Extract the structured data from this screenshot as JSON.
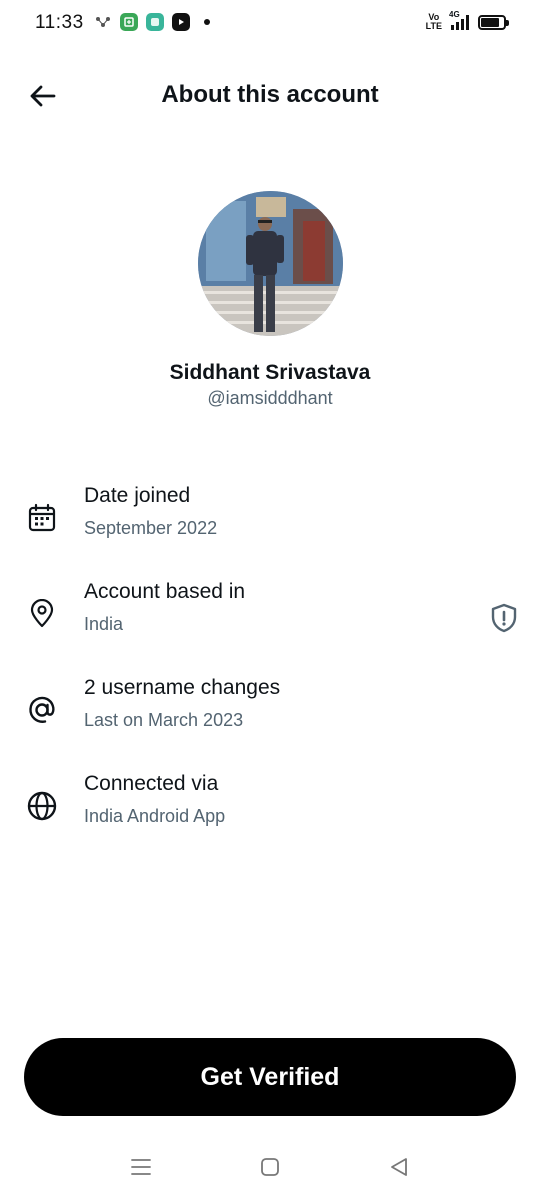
{
  "status_bar": {
    "time": "11:33",
    "network_label": "4G",
    "volte_top": "Vo",
    "volte_bottom": "LTE",
    "left_icons": [
      "phone-link-icon",
      "app-icon-green",
      "app-icon-teal",
      "youtube-icon",
      "notification-dot"
    ],
    "battery_level": 0.8
  },
  "header": {
    "title": "About this account"
  },
  "profile": {
    "name": "Siddhant Srivastava",
    "handle": "@iamsidddhant"
  },
  "info": [
    {
      "icon": "calendar-icon",
      "label": "Date joined",
      "value": "September 2022"
    },
    {
      "icon": "location-pin-icon",
      "label": "Account based in",
      "value": "India"
    },
    {
      "icon": "at-sign-icon",
      "label": "2 username changes",
      "value": "Last on March 2023"
    },
    {
      "icon": "globe-icon",
      "label": "Connected via",
      "value": "India Android App"
    }
  ],
  "cta": {
    "label": "Get Verified"
  },
  "colors": {
    "primary_text": "#0f1419",
    "secondary_text": "#536471",
    "button_bg": "#000000",
    "button_text": "#ffffff"
  }
}
